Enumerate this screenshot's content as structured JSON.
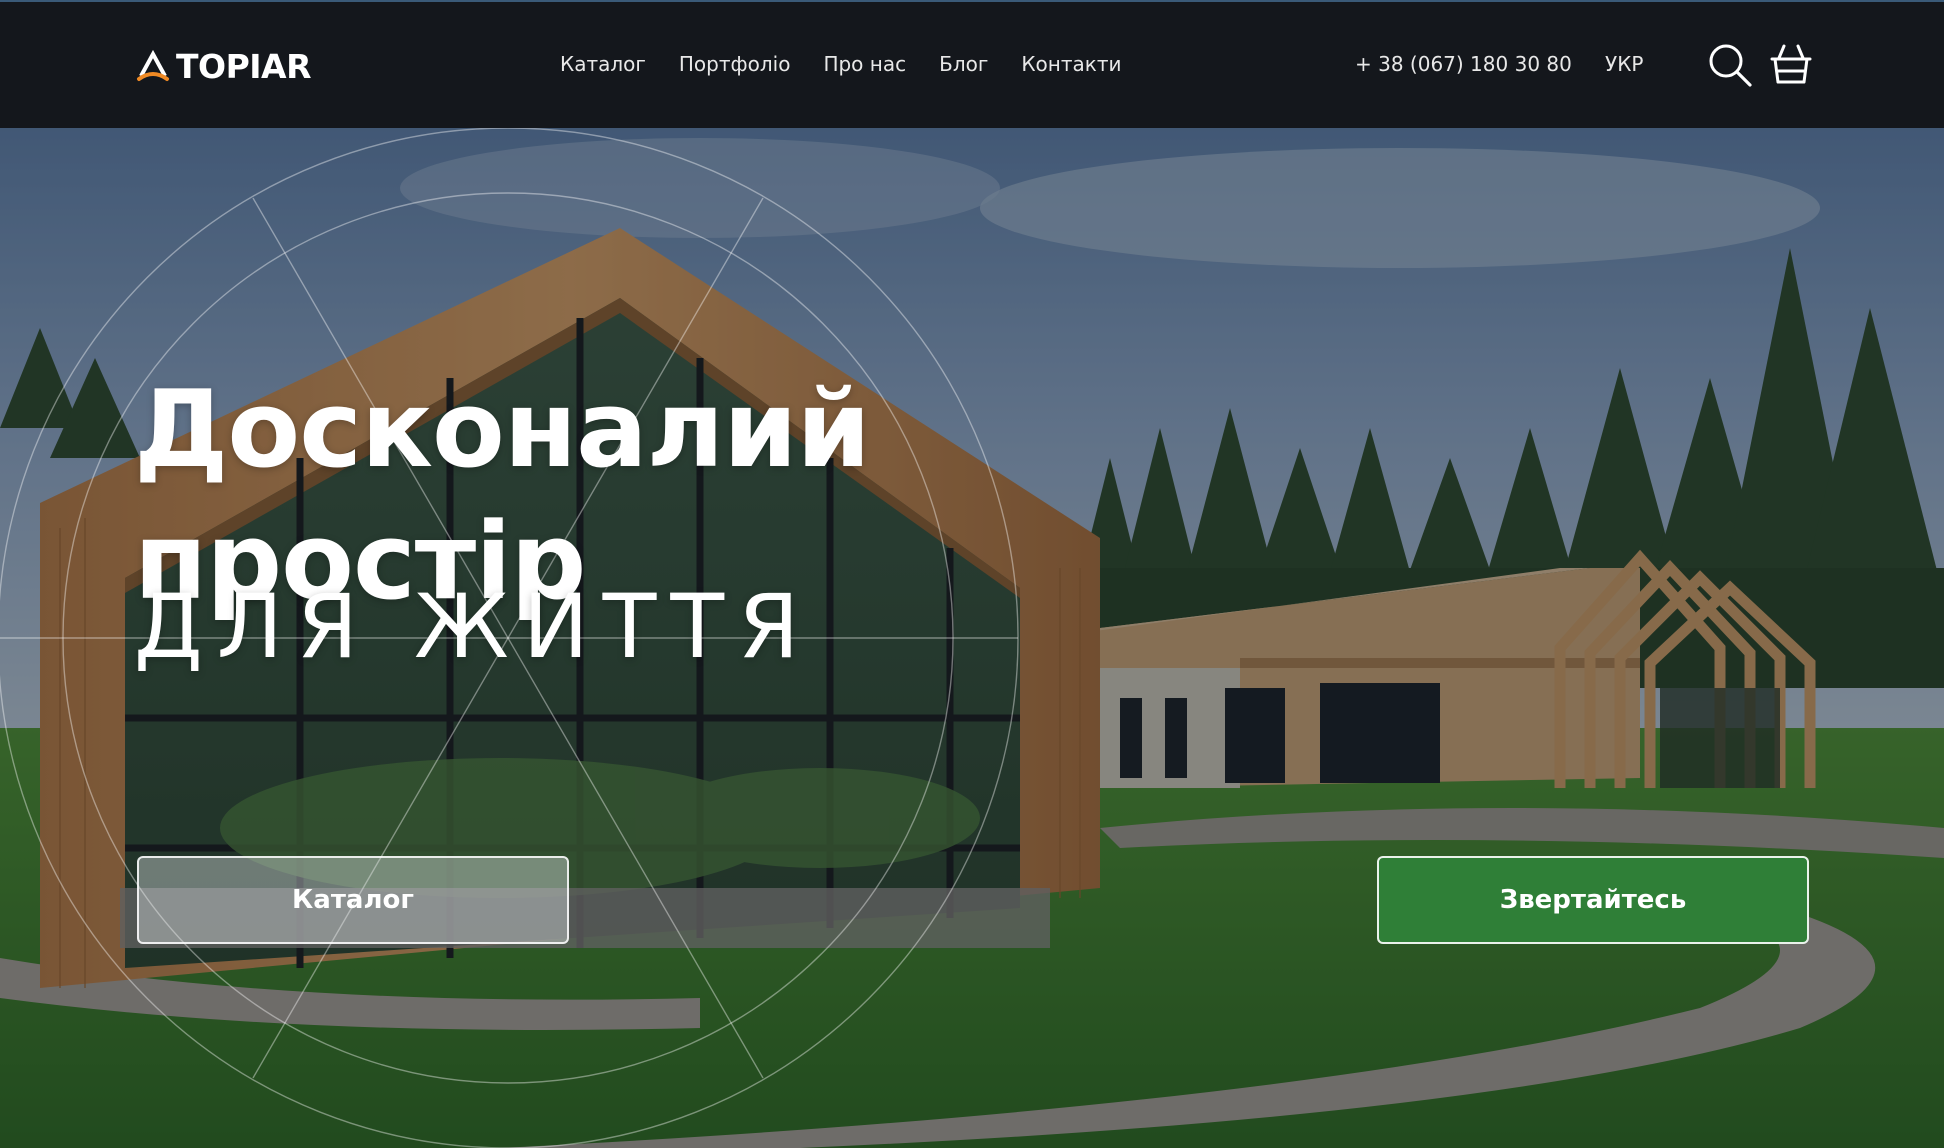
{
  "brand": {
    "name": "TOPIAR",
    "accent_color": "#f08a24"
  },
  "nav": {
    "items": [
      "Каталог",
      "Портфоліо",
      "Про нас",
      "Блог",
      "Контакти"
    ]
  },
  "header": {
    "phone": "+ 38 (067) 180 30 80",
    "language": "УКР",
    "search_icon": "search-icon",
    "cart_icon": "cart-icon"
  },
  "hero": {
    "title_line1": "Досконалий",
    "title_line2": "простір",
    "subtitle": "ДЛЯ ЖИТТЯ",
    "catalog_button": "Каталог",
    "contact_button": "Звертайтесь",
    "contact_button_color": "#2f7f37"
  }
}
